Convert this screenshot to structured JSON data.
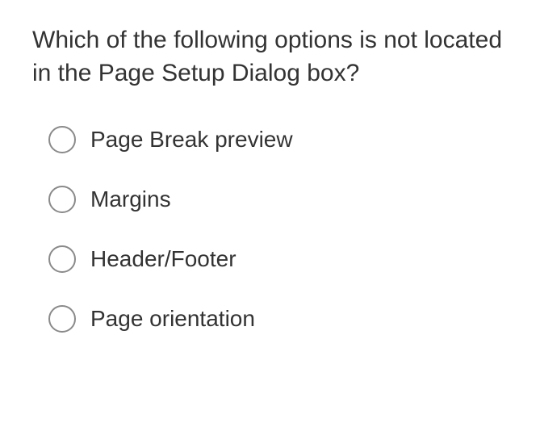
{
  "question": "Which of the following options is not located in the Page Setup Dialog box?",
  "options": [
    {
      "label": "Page Break preview"
    },
    {
      "label": "Margins"
    },
    {
      "label": "Header/Footer"
    },
    {
      "label": "Page orientation"
    }
  ]
}
